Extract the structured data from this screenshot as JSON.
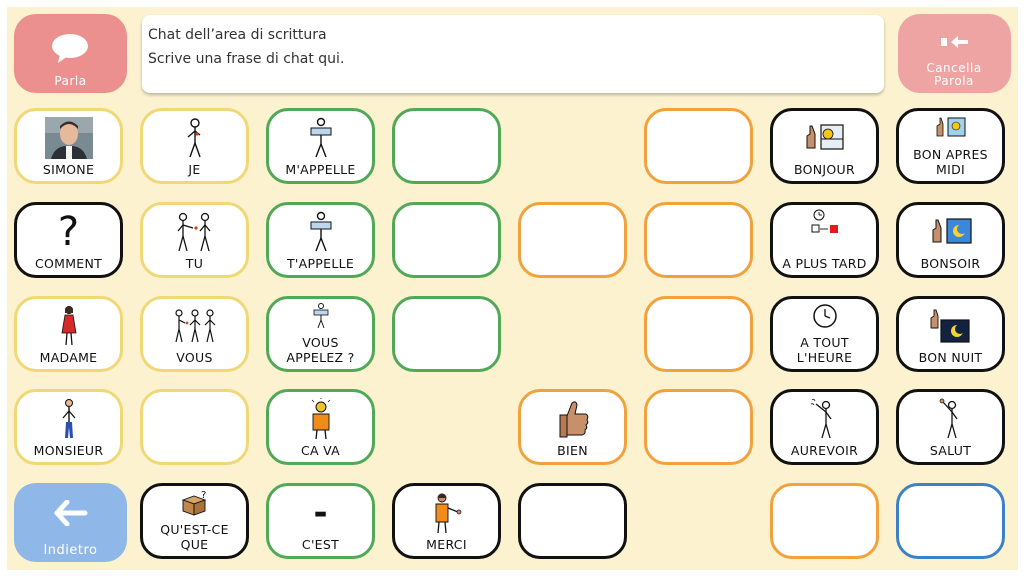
{
  "top": {
    "speak_label": "Parla",
    "clear_label": "Cancella Parola",
    "back_label": "Indietro"
  },
  "chat": {
    "title": "Chat dell’area di scrittura",
    "text": "Scrive una frase di chat qui."
  },
  "tiles": {
    "simone": "SIMONE",
    "je": "JE",
    "mappelle": "M'APPELLE",
    "bonjour": "BONJOUR",
    "bon_apres_midi": "BON APRES MIDI",
    "comment": "COMMENT",
    "tu": "TU",
    "tappelle": "T'APPELLE",
    "a_plus_tard": "A PLUS TARD",
    "bonsoir": "BONSOIR",
    "madame": "MADAME",
    "vous": "VOUS",
    "vous_appelez": "VOUS APPELEZ ?",
    "a_tout_lheure": "A TOUT L'HEURE",
    "bon_nuit": "BON NUIT",
    "monsieur": "MONSIEUR",
    "ca_va": "CA VA",
    "bien": "BIEN",
    "aurevoir": "AUREVOIR",
    "salut": "SALUT",
    "quest_ce_que": "QU'EST-CE QUE",
    "cest": "C'EST",
    "merci": "MERCI",
    "question_mark": "?",
    "dash": "-"
  },
  "colors": {
    "background": "#fdf2cf",
    "speak": "#ec8f8f",
    "clear": "#efa4a4",
    "back": "#8fb7e8",
    "yellow": "#f1d877",
    "green": "#51a958",
    "black": "#111111",
    "orange": "#f2a23c",
    "blue": "#3d82c7"
  }
}
